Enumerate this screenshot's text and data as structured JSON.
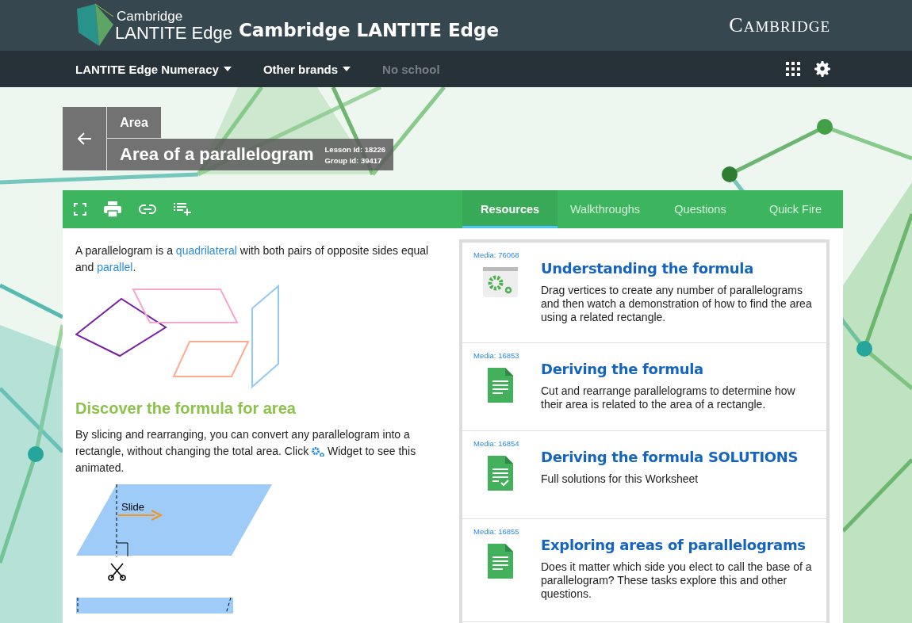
{
  "header": {
    "logo_line1": "Cambridge",
    "logo_line2": "LANTITE Edge",
    "site_title": "Cambridge LANTITE Edge",
    "brand": "CAMBRIDGE"
  },
  "nav": [
    {
      "label": "LANTITE Edge Numeracy",
      "dropdown": true,
      "disabled": false
    },
    {
      "label": "Other brands",
      "dropdown": true,
      "disabled": false
    },
    {
      "label": "No school",
      "dropdown": false,
      "disabled": true
    }
  ],
  "breadcrumb": {
    "parent": "Area",
    "title": "Area of a parallelogram",
    "lesson_id": "Lesson Id: 18226",
    "group_id": "Group Id: 39417"
  },
  "tabs": [
    {
      "label": "Resources",
      "selected": true
    },
    {
      "label": "Walkthroughs",
      "selected": false
    },
    {
      "label": "Questions",
      "selected": false
    },
    {
      "label": "Quick Fire",
      "selected": false
    }
  ],
  "content": {
    "intro": [
      {
        "kind": "text",
        "text": "A parallelogram is a "
      },
      {
        "kind": "link",
        "text": "quadrilateral"
      },
      {
        "kind": "text",
        "text": " with both pairs of opposite sides equal and "
      },
      {
        "kind": "link",
        "text": "parallel"
      },
      {
        "kind": "text",
        "text": "."
      }
    ],
    "heading": "Discover the formula for area",
    "body": [
      {
        "kind": "text",
        "text": "By slicing and rearranging, you can convert any parallelogram into a rectangle, without changing the total area. Click "
      },
      {
        "kind": "gear"
      },
      {
        "kind": "text",
        "text": " Widget to see this animated."
      }
    ],
    "slide_label": "Slide"
  },
  "resources": [
    {
      "kind": "widget",
      "media": "Media: 76068",
      "title": "Understanding the formula",
      "description": "Drag vertices to create any number of parallelograms and then watch a demonstration of how to find the area using a related rectangle."
    },
    {
      "kind": "document",
      "media": "Media: 16853",
      "title": "Deriving the formula",
      "description": "Cut and rearrange parallelograms to determine how their area is related to the area of a rectangle."
    },
    {
      "kind": "solutions",
      "media": "Media: 16854",
      "title": "Deriving the formula SOLUTIONS",
      "description": "Full solutions for this Worksheet"
    },
    {
      "kind": "document",
      "media": "Media: 16855",
      "title": "Exploring areas of parallelograms",
      "description": "Does it matter which side you elect to call the base of a parallelogram? These tasks explore this and other questions."
    }
  ]
}
